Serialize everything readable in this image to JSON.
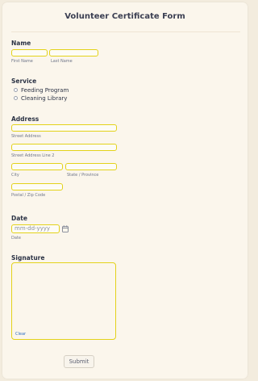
{
  "form": {
    "title": "Volunteer Certificate Form",
    "name": {
      "label": "Name",
      "first_sub": "First Name",
      "last_sub": "Last Name"
    },
    "service": {
      "label": "Service",
      "options": [
        "Feeding Program",
        "Cleaning Library"
      ]
    },
    "address": {
      "label": "Address",
      "street": "Street Address",
      "street2": "Street Address Line 2",
      "city": "City",
      "state": "State / Province",
      "postal": "Postal / Zip Code"
    },
    "date": {
      "label": "Date",
      "placeholder": "mm-dd-yyyy",
      "sub": "Date"
    },
    "signature": {
      "label": "Signature",
      "clear": "Clear"
    },
    "submit": "Submit"
  },
  "colors": {
    "input_border": "#e3d21a",
    "card_bg": "#fbf6ec",
    "page_bg": "#f3ecde",
    "link": "#2d6ec5"
  },
  "icons": {
    "date_picker": "calendar-icon"
  }
}
